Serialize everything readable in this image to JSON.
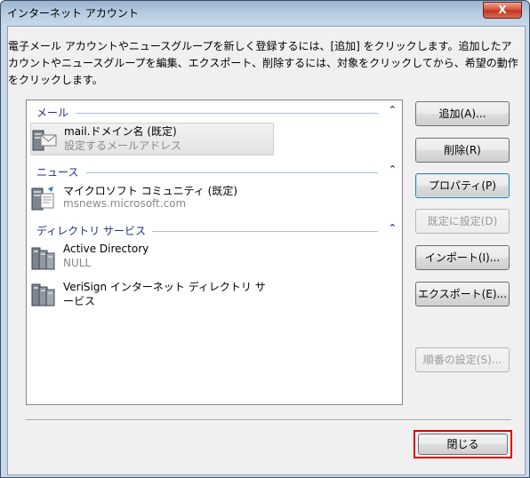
{
  "window": {
    "title": "インターネット アカウント",
    "close_glyph": "X"
  },
  "description": "電子メール アカウントやニュースグループを新しく登録するには、[追加] をクリックします。追加したアカウントやニュースグループを編集、エクスポート、削除するには、対象をクリックしてから、希望の動作をクリックします。",
  "groups": [
    {
      "title": "メール",
      "collapse_glyph": "⌃",
      "items": [
        {
          "name": "mail.ドメイン名 (既定)",
          "sub": "設定するメールアドレス",
          "icon": "mail-server-icon",
          "selected": true
        }
      ]
    },
    {
      "title": "ニュース",
      "collapse_glyph": "⌃",
      "items": [
        {
          "name": "マイクロソフト コミュニティ (既定)",
          "sub": "msnews.microsoft.com",
          "icon": "news-server-icon",
          "selected": false
        }
      ]
    },
    {
      "title": "ディレクトリ サービス",
      "collapse_glyph": "⌃",
      "items": [
        {
          "name": "Active Directory",
          "sub": "NULL",
          "icon": "directory-server-icon",
          "selected": false
        },
        {
          "name": "VeriSign インターネット ディレクトリ サ",
          "sub": "ービス",
          "icon": "directory-server-icon",
          "selected": false
        }
      ]
    }
  ],
  "buttons": {
    "add": "追加(A)...",
    "remove": "削除(R)",
    "properties": "プロパティ(P)",
    "set_default": "既定に設定(D)",
    "import": "インポート(I)...",
    "export": "エクスポート(E)...",
    "order": "順番の設定(S)...",
    "close": "閉じる"
  },
  "colors": {
    "group_title": "#1e3287",
    "highlight_border": "#e00000",
    "title_gradient": "#b8cce2"
  }
}
